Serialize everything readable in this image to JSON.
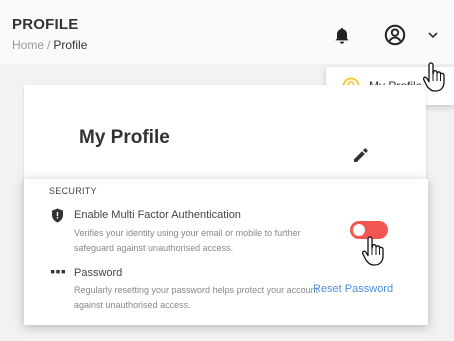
{
  "header": {
    "title": "PROFILE",
    "breadcrumb": {
      "home": "Home",
      "separator": "/",
      "current": "Profile"
    },
    "icons": [
      "bell-icon",
      "user-circle-icon",
      "chevron-down-icon"
    ]
  },
  "user_menu": {
    "items": [
      {
        "label": "My Profile",
        "icon": "user-circle-icon"
      }
    ],
    "icon_color": "#f5c518"
  },
  "profile_card": {
    "heading": "My Profile",
    "edit_icon": "pencil-icon"
  },
  "security": {
    "section_label": "SECURITY",
    "mfa": {
      "title": "Enable Multi Factor Authentication",
      "description": "Verifies your identity using your email or mobile to further safeguard against unauthorised access.",
      "enabled": false,
      "toggle_color": "#f25650"
    },
    "password": {
      "title": "Password",
      "description": "Regularly resetting your password helps protect your account against unauthorised access.",
      "action_label": "Reset Password",
      "link_color": "#4a90e2"
    }
  }
}
